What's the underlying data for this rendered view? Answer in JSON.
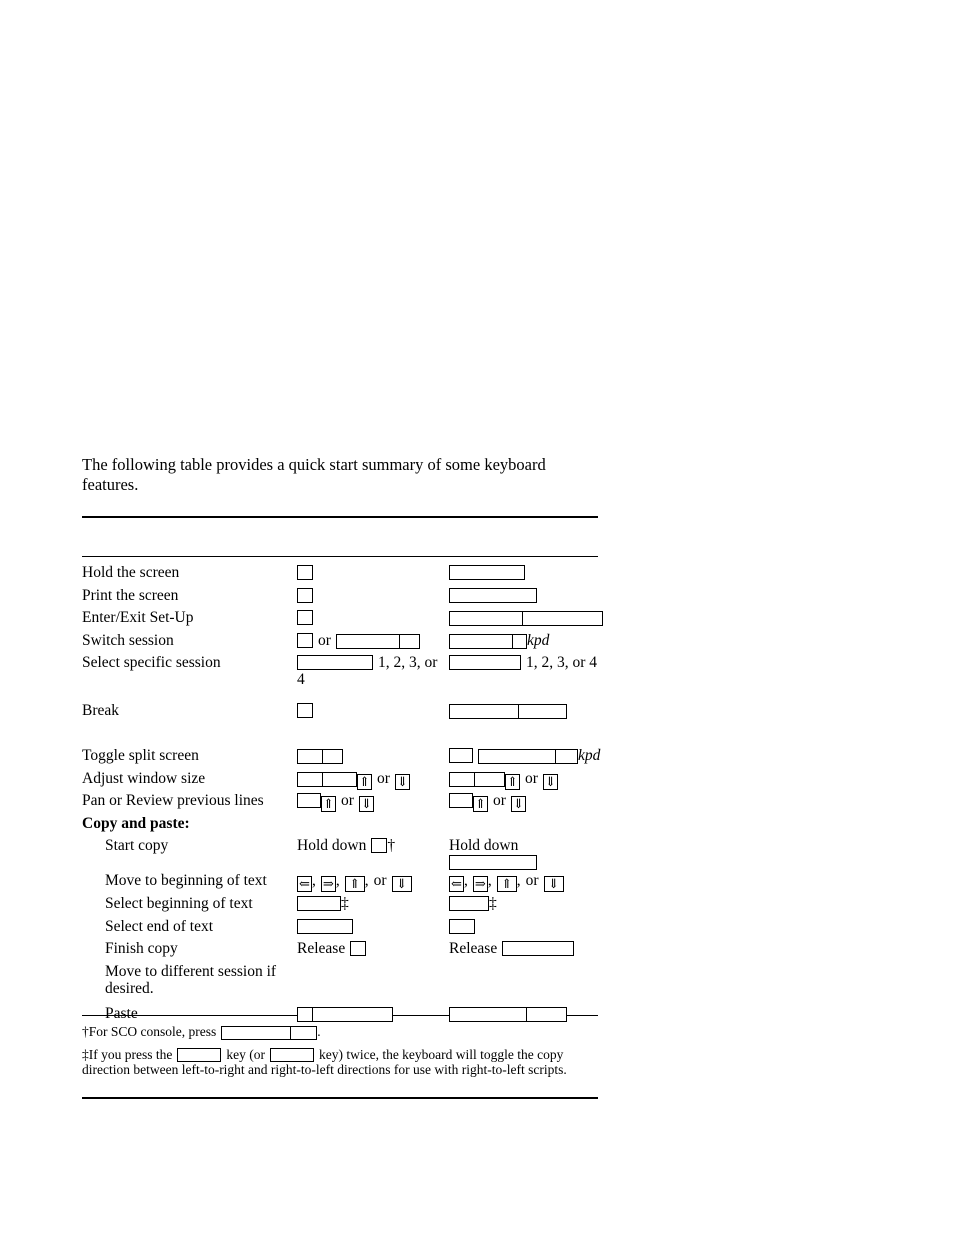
{
  "document": {
    "intro": "The following table provides a quick start summary of some keyboard features."
  },
  "table": {
    "rows": [
      {
        "label": "Hold the screen",
        "indent": false
      },
      {
        "label": "Print the screen",
        "indent": false
      },
      {
        "label": "Enter/Exit Set-Up",
        "indent": false
      },
      {
        "label": "Switch session",
        "indent": false,
        "colA_or": "or",
        "colB_note": "kpd"
      },
      {
        "label": "Select specific session",
        "indent": false,
        "colA_note": "1, 2, 3, or 4",
        "colB_note": "1, 2, 3, or 4"
      },
      {
        "label": "Break",
        "indent": false
      },
      {
        "label": "Toggle split screen",
        "indent": false,
        "colB_note": "kpd"
      },
      {
        "label": "Adjust window size",
        "indent": false,
        "colA_or": "or",
        "colB_or": "or"
      },
      {
        "label": "Pan or Review previous lines",
        "indent": false,
        "colA_or": "or",
        "colB_or": "or"
      },
      {
        "label": "Copy and paste:",
        "indent": false,
        "heading": true
      },
      {
        "label": "Start copy",
        "indent": true,
        "colA_lead": "Hold down",
        "colA_mark": "†",
        "colB_lead": "Hold down"
      },
      {
        "label": "Move to beginning of text",
        "indent": true,
        "colA_or": "or",
        "colB_or": "or"
      },
      {
        "label": "Select beginning of text",
        "indent": true,
        "colA_mark": "‡",
        "colB_mark": "‡"
      },
      {
        "label": "Select end of text",
        "indent": true
      },
      {
        "label": "Finish copy",
        "indent": true,
        "colA_lead": "Release",
        "colB_lead": "Release"
      },
      {
        "label": "Move to different session if desired.",
        "indent": true
      },
      {
        "label": "Paste",
        "indent": true
      }
    ],
    "arrows": {
      "left": "⇐",
      "right": "⇒",
      "up": "⇑",
      "down": "⇓"
    },
    "separators": {
      "comma": ",",
      "or": "or"
    }
  },
  "footnotes": [
    {
      "marker": "†",
      "text_before": "For SCO console, press",
      "text_after": "."
    },
    {
      "marker": "‡",
      "text_before": "If you press the",
      "text_middle": "key (or",
      "text_middle2": "key) twice, the keyboard will toggle the copy direction between left-to-right and right-to-left directions for use with right-to-left scripts."
    }
  ],
  "colors": {
    "ink": "#000000",
    "paper": "#ffffff"
  }
}
